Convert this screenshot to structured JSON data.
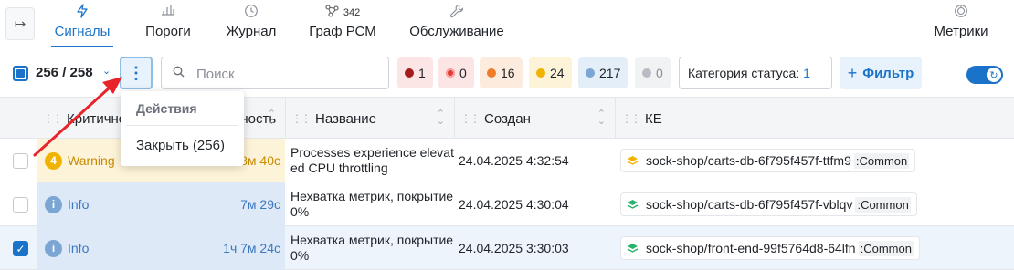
{
  "nav": {
    "tabs": [
      {
        "label": "Сигналы",
        "icon": "lightning-icon",
        "active": true
      },
      {
        "label": "Пороги",
        "icon": "thresholds-icon",
        "active": false
      },
      {
        "label": "Журнал",
        "icon": "history-icon",
        "active": false
      },
      {
        "label": "Граф РСМ",
        "icon": "graph-icon",
        "active": false,
        "count": "342"
      },
      {
        "label": "Обслуживание",
        "icon": "wrench-icon",
        "active": false
      },
      {
        "label": "Метрики",
        "icon": "gauge-icon",
        "active": false
      }
    ]
  },
  "toolbar": {
    "selection_count": "256 / 258",
    "search_placeholder": "Поиск",
    "chips": [
      {
        "count": "1",
        "color": "#a61c1c",
        "bg": "#fbe5e5"
      },
      {
        "count": "0",
        "color": "#e53935",
        "bg": "#fbe5e5"
      },
      {
        "count": "16",
        "color": "#ef7c26",
        "bg": "#fdecde"
      },
      {
        "count": "24",
        "color": "#f0b400",
        "bg": "#fdf3d9"
      },
      {
        "count": "217",
        "color": "#7ba6d4",
        "bg": "#e4eef8"
      },
      {
        "count": "0",
        "color": "#b8bcc2",
        "bg": "#f1f2f4"
      }
    ],
    "status_category_label": "Категория статуса:",
    "status_category_value": "1",
    "filter_label": "Фильтр"
  },
  "table": {
    "columns": [
      {
        "label": "Критичность"
      },
      {
        "label": "Длительность"
      },
      {
        "label": "Название"
      },
      {
        "label": "Создан"
      },
      {
        "label": "КЕ"
      }
    ],
    "rows": [
      {
        "checked": false,
        "severity": "warning",
        "severity_badge": "4",
        "severity_label": "Warning",
        "duration": "8м 40с",
        "name": "Processes experience elevated CPU throttling",
        "created": "24.04.2025 4:32:54",
        "ke_name": "sock-shop/carts-db-6f795f457f-ttfm9",
        "ke_type": ":Common",
        "ke_color": "#f0b400"
      },
      {
        "checked": false,
        "severity": "info",
        "severity_badge": "i",
        "severity_label": "Info",
        "duration": "7м 29с",
        "name": "Нехватка метрик, покрытие 0%",
        "created": "24.04.2025 4:30:04",
        "ke_name": "sock-shop/carts-db-6f795f457f-vblqv",
        "ke_type": ":Common",
        "ke_color": "#26b36a"
      },
      {
        "checked": true,
        "severity": "info",
        "severity_badge": "i",
        "severity_label": "Info",
        "duration": "1ч 7м 24с",
        "name": "Нехватка метрик, покрытие 0%",
        "created": "24.04.2025 3:30:03",
        "ke_name": "sock-shop/front-end-99f5764d8-64lfn",
        "ke_type": ":Common",
        "ke_color": "#26b36a"
      }
    ]
  },
  "menu": {
    "title": "Действия",
    "items": [
      {
        "label": "Закрыть (256)"
      }
    ]
  },
  "colors": {
    "accent": "#1a73c9",
    "annotation_arrow": "#e8232a"
  }
}
